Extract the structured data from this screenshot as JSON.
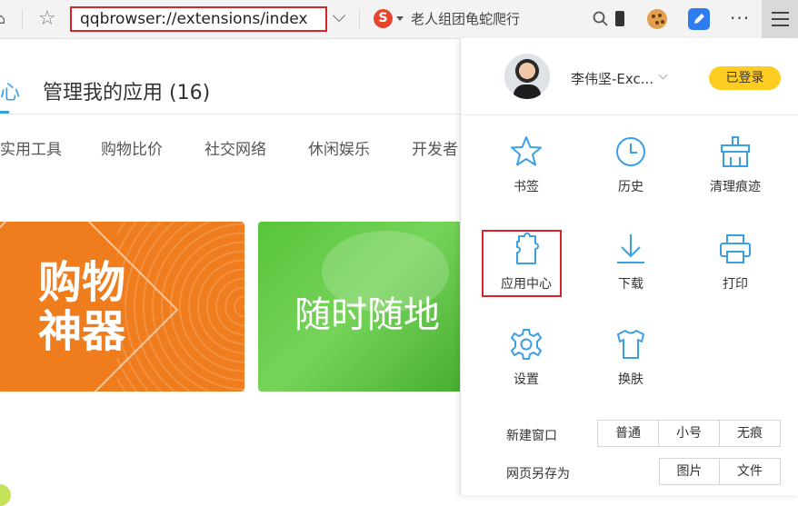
{
  "toolbar": {
    "address": "qqbrowser://extensions/index",
    "search_engine_label": "S",
    "search_text": "老人组团龟蛇爬行",
    "more_label": "···"
  },
  "page": {
    "tab_fragment": "心",
    "title": "管理我的应用 (16)",
    "categories": [
      "实用工具",
      "购物比价",
      "社交网络",
      "休闲娱乐",
      "开发者"
    ],
    "banner_orange_line1": "购物",
    "banner_orange_line2": "神器",
    "banner_green_text": "随时随地"
  },
  "panel": {
    "username": "李伟坚-Exc...",
    "login_status": "已登录",
    "items": [
      {
        "label": "书签",
        "icon": "star-icon"
      },
      {
        "label": "历史",
        "icon": "clock-icon"
      },
      {
        "label": "清理痕迹",
        "icon": "broom-icon"
      },
      {
        "label": "应用中心",
        "icon": "puzzle-icon"
      },
      {
        "label": "下载",
        "icon": "download-icon"
      },
      {
        "label": "打印",
        "icon": "printer-icon"
      },
      {
        "label": "设置",
        "icon": "gear-icon"
      },
      {
        "label": "换肤",
        "icon": "shirt-icon"
      }
    ],
    "new_window": {
      "label": "新建窗口",
      "options": [
        "普通",
        "小号",
        "无痕"
      ]
    },
    "save_page": {
      "label": "网页另存为",
      "options": [
        "图片",
        "文件"
      ]
    }
  },
  "colors": {
    "accent": "#3aa0e4",
    "highlight": "#d9222a",
    "badge": "#ffcc22"
  }
}
